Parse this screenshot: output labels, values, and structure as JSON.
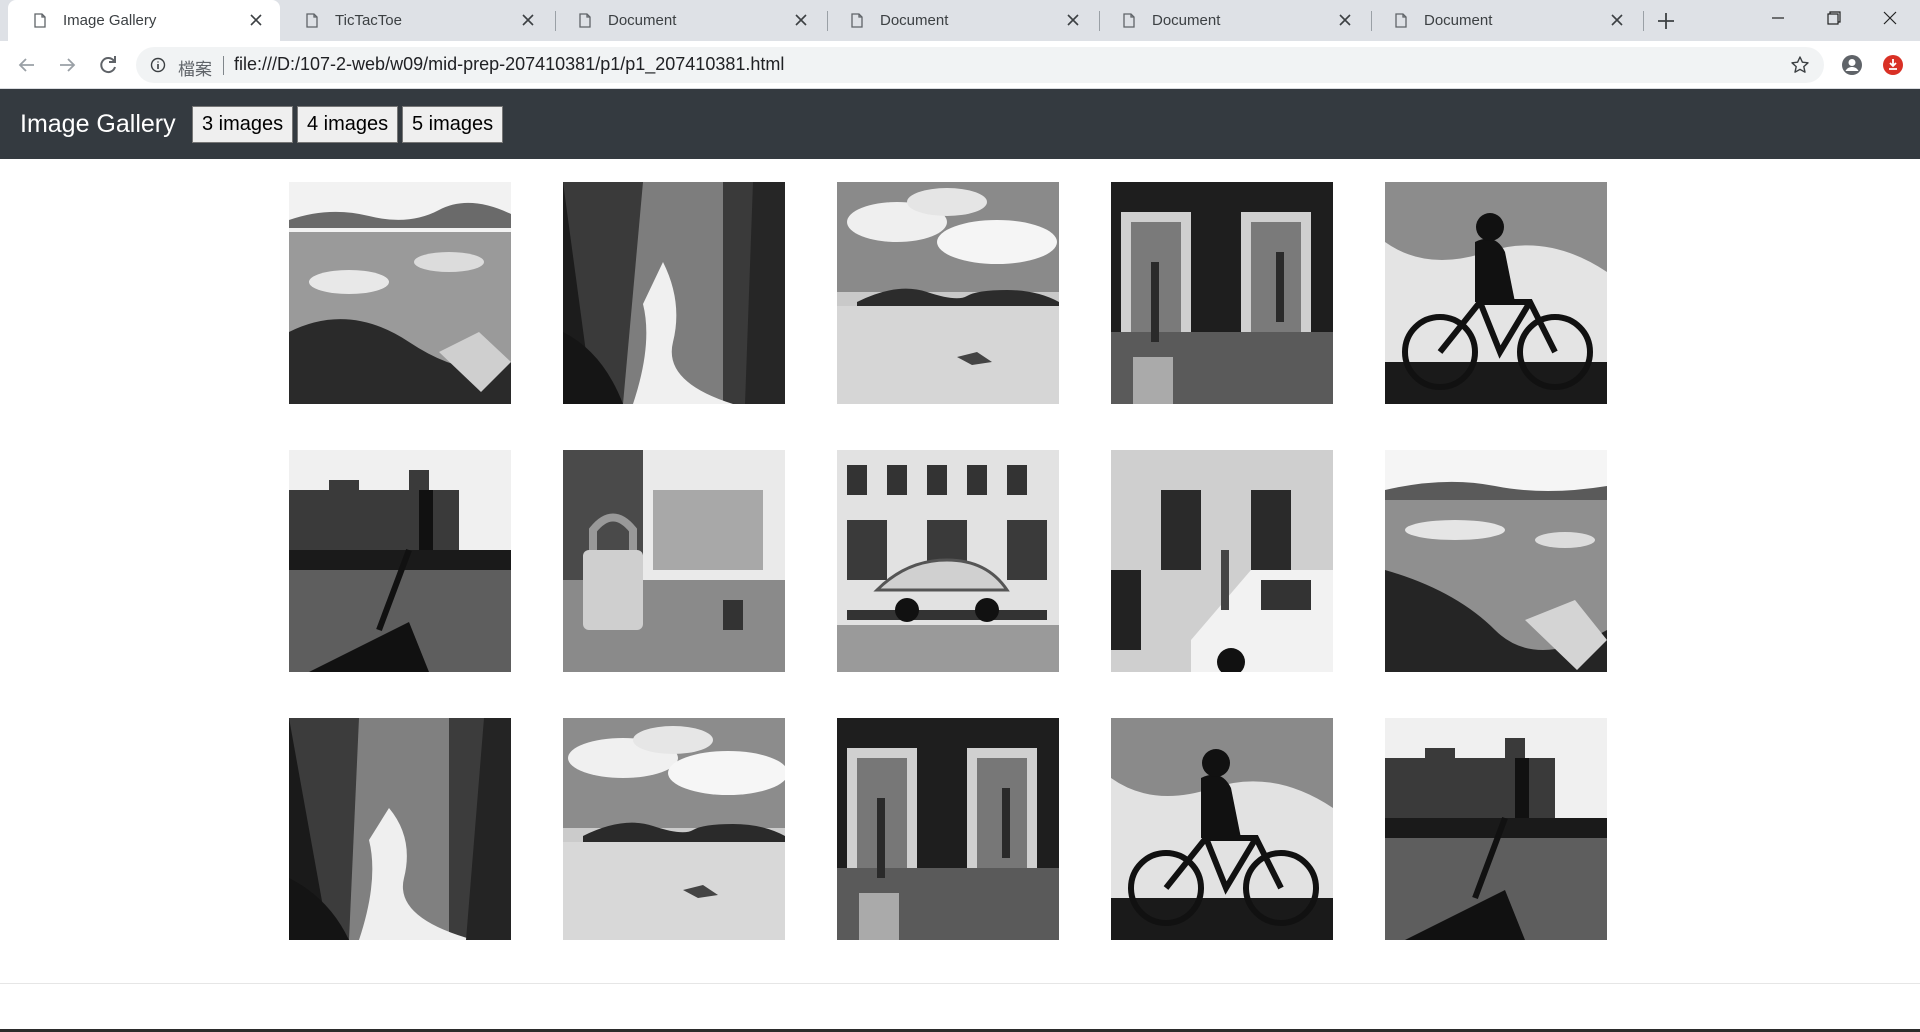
{
  "browser": {
    "tabs": [
      {
        "title": "Image Gallery",
        "active": true
      },
      {
        "title": "TicTacToe",
        "active": false
      },
      {
        "title": "Document",
        "active": false
      },
      {
        "title": "Document",
        "active": false
      },
      {
        "title": "Document",
        "active": false
      },
      {
        "title": "Document",
        "active": false
      }
    ],
    "omnibox": {
      "label": "檔案",
      "url": "file:///D:/107-2-web/w09/mid-prep-207410381/p1/p1_207410381.html"
    },
    "icons": {
      "tab": "page-icon",
      "close": "close-icon",
      "new_tab": "plus-icon",
      "back": "back-arrow-icon",
      "forward": "forward-arrow-icon",
      "reload": "reload-icon",
      "info": "info-icon",
      "star": "star-icon",
      "profile": "profile-icon",
      "extension": "extension-icon"
    },
    "accent_colors": {
      "tabstrip": "#dee1e6",
      "extension": "#d93025"
    }
  },
  "navbar": {
    "brand": "Image Gallery",
    "buttons": [
      "3 images",
      "4 images",
      "5 images"
    ],
    "background": "#343a40"
  },
  "gallery": {
    "columns": 5,
    "images": [
      {
        "subject": "glacier-lagoon"
      },
      {
        "subject": "forest-waterfall"
      },
      {
        "subject": "desert-dunes-clouds"
      },
      {
        "subject": "station-lifts-people"
      },
      {
        "subject": "cyclist-silhouette"
      },
      {
        "subject": "walker-silhouette-city"
      },
      {
        "subject": "padlock-street"
      },
      {
        "subject": "classic-car-trailer"
      },
      {
        "subject": "building-van-man"
      },
      {
        "subject": "glacier-lagoon"
      },
      {
        "subject": "forest-waterfall"
      },
      {
        "subject": "desert-dunes-clouds"
      },
      {
        "subject": "station-lifts-people"
      },
      {
        "subject": "cyclist-silhouette"
      },
      {
        "subject": "walker-silhouette-city"
      }
    ]
  }
}
